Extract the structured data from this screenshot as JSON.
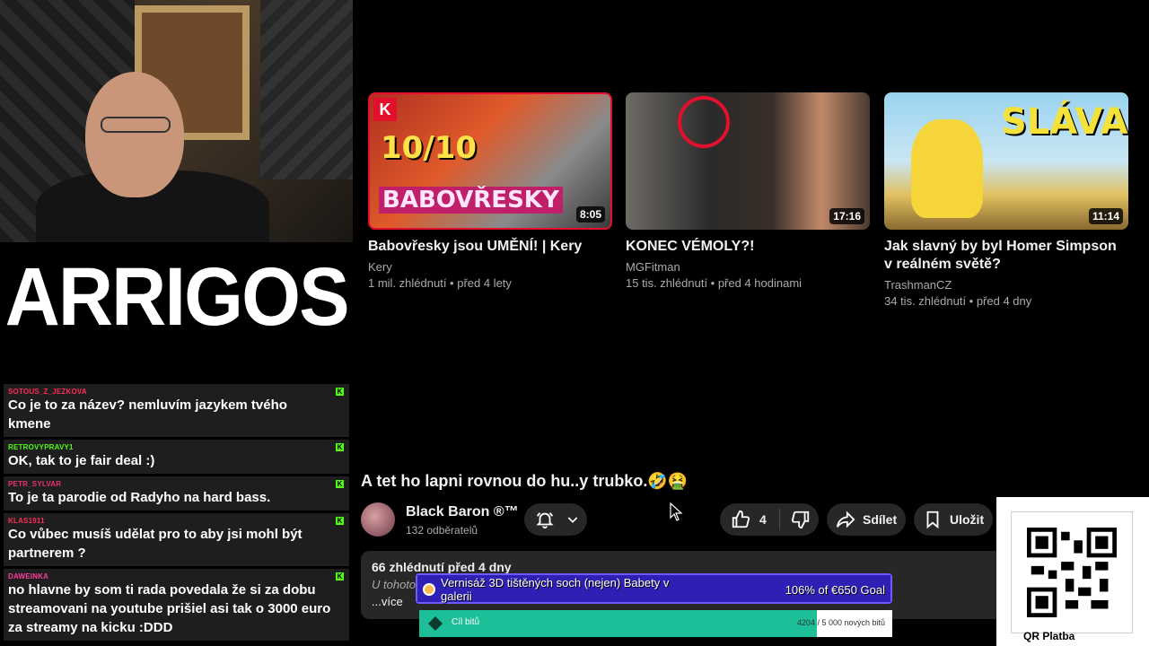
{
  "logo": {
    "text": "ARRIGOS"
  },
  "chat": {
    "messages": [
      {
        "user": "SOTOUS_Z_JEZKOVA",
        "color": "#ff2d55",
        "text": "Co je to za název? nemluvím jazykem tvého kmene"
      },
      {
        "user": "RETROVYPRAVY1",
        "color": "#53fc18",
        "text": "OK, tak to je fair deal :)"
      },
      {
        "user": "PETR_SYLVAR",
        "color": "#e8346b",
        "text": "To je ta parodie od Radyho na hard bass."
      },
      {
        "user": "KLAS1911",
        "color": "#ff2d55",
        "text": "Co vůbec musíš udělat pro to aby jsi mohl být partnerem ?"
      },
      {
        "user": "DAWEINKA",
        "color": "#ff3da0",
        "text": "no hlavne by som ti rada povedala že si za dobu streamovani na youtube prišiel asi tak o 3000 euro za streamy na kicku :DDD"
      }
    ]
  },
  "videos": [
    {
      "title": "Babovřesky jsou UMĚNÍ! | Kery",
      "channel": "Kery",
      "meta": "1 mil. zhlédnutí • před 4 lety",
      "duration": "8:05",
      "thumb_top": "10/10",
      "thumb_bottom": "BABOVŘESKY"
    },
    {
      "title": "KONEC VÉMOLY?!",
      "channel": "MGFitman",
      "meta": "15 tis. zhlédnutí • před 4 hodinami",
      "duration": "17:16"
    },
    {
      "title": "Jak slavný by byl Homer Simpson v reálném světě?",
      "channel": "TrashmanCZ",
      "meta": "34 tis. zhlédnutí • před 4 dny",
      "duration": "11:14",
      "thumb_top": "SLÁVA"
    }
  ],
  "video": {
    "title": "A tet ho lapni rovnou do hu..y trubko.🤣🤮",
    "channel": "Black Baron ®™",
    "subscribers": "132 odběratelů",
    "likes": "4",
    "share_label": "Sdílet",
    "save_label": "Uložit",
    "description": {
      "views": "66 zhlédnutí  před 4 dny",
      "text": "U tohoto",
      "more": "...více"
    }
  },
  "goal1": {
    "title": "Vernisáž 3D tištěných soch (nejen) Babety v galerii",
    "amount": "106% of €650 Goal",
    "progress": 1.0
  },
  "goal2": {
    "label": "Cíl bitů",
    "amount": "4204 / 5 000 nových bitů",
    "progress": 0.84
  },
  "qr": {
    "label": "QR Platba"
  }
}
